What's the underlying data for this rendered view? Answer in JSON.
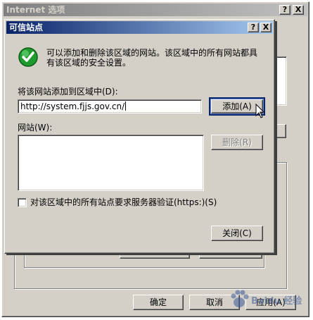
{
  "outer_window": {
    "title": "Internet 选项",
    "help_button": "?",
    "close_button": "X",
    "ok_label": "确定",
    "cancel_label": "取消",
    "apply_label": "应用(A)"
  },
  "dialog": {
    "title": "可信站点",
    "help_button": "?",
    "close_button": "X",
    "info_line1": "可以添加和删除该区域的网站。该区域中的所有网站都具",
    "info_line2": "有该区域的安全设置。",
    "add_label": "将该网站添加到区域中(D):",
    "url_value": "http://system.fjjs.gov.cn/",
    "add_button": "添加(A)",
    "sites_label": "网站(W):",
    "sites": [],
    "remove_button": "删除(R)",
    "https_checkbox_label": "对该区域中的所有站点要求服务器验证(https:)(S)",
    "https_checked": false,
    "close_label": "关闭(C)"
  },
  "watermark": "Baidu 经验",
  "colors": {
    "face": "#d4d0c8",
    "active_title_start": "#0a246a",
    "active_title_end": "#a6caf0",
    "check_green": "#1e9b2e"
  }
}
